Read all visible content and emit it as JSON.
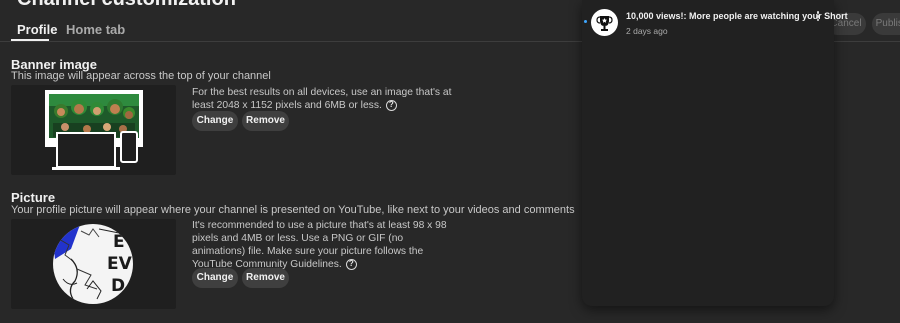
{
  "header": {
    "title": "Channel customization",
    "cancel_label": "Cancel",
    "publish_label": "Publish"
  },
  "tabs": [
    {
      "label": "Profile",
      "active": true
    },
    {
      "label": "Home tab",
      "active": false
    }
  ],
  "banner": {
    "title": "Banner image",
    "subtitle": "This image will appear across the top of your channel",
    "help_line1": "For the best results on all devices, use an image that's at",
    "help_line2": "least 2048 x 1152 pixels and 6MB or less.",
    "change_label": "Change",
    "remove_label": "Remove"
  },
  "picture": {
    "title": "Picture",
    "subtitle": "Your profile picture will appear where your channel is presented on YouTube, like next to your videos and comments",
    "help_line1": "It's recommended to use a picture that's at least 98 x 98",
    "help_line2": "pixels and 4MB or less. Use a PNG or GIF (no",
    "help_line3": "animations) file. Make sure your picture follows the",
    "help_line4": "YouTube Community Guidelines.",
    "change_label": "Change",
    "remove_label": "Remove"
  },
  "notification": {
    "title": "10,000 views!: More people are watching your Short",
    "time": "2 days ago",
    "icon": "trophy-icon",
    "unread": true
  },
  "colors": {
    "background": "#282828",
    "panel": "#212121",
    "button": "#3f3f3f",
    "unread_dot": "#3ea6ff",
    "text": "#f1f1f1",
    "text_secondary": "#aaaaaa"
  }
}
